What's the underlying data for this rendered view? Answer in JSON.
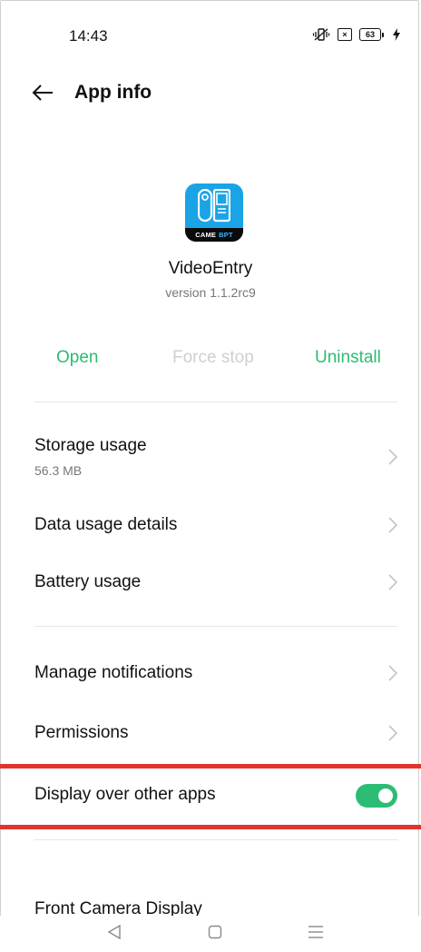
{
  "status_bar": {
    "time": "14:43",
    "sim_label": "×",
    "battery_level": "63",
    "icons": [
      "vibrate-icon",
      "sim-error-icon",
      "battery-icon",
      "charging-icon"
    ]
  },
  "header": {
    "title": "App info",
    "back_icon": "back-arrow-icon"
  },
  "app": {
    "name": "VideoEntry",
    "version": "version 1.1.2rc9",
    "icon_brand_left": "CAME",
    "icon_brand_right": "BPT",
    "icon_color": "#1aa4e6"
  },
  "actions": {
    "open": "Open",
    "force_stop": "Force stop",
    "uninstall": "Uninstall",
    "accent_color": "#2bbd73",
    "disabled_color": "#cfcfcf"
  },
  "rows": {
    "storage": {
      "label": "Storage usage",
      "sub": "56.3 MB"
    },
    "data_usage": {
      "label": "Data usage details"
    },
    "battery": {
      "label": "Battery usage"
    },
    "notifications": {
      "label": "Manage notifications"
    },
    "permissions": {
      "label": "Permissions"
    },
    "display_over": {
      "label": "Display over other apps",
      "enabled": true
    },
    "front_camera": {
      "label": "Front Camera Display"
    }
  },
  "highlight_color": "#e0342f",
  "nav": {
    "back_icon": "nav-back-icon",
    "home_icon": "nav-home-icon",
    "recents_icon": "nav-menu-icon"
  }
}
